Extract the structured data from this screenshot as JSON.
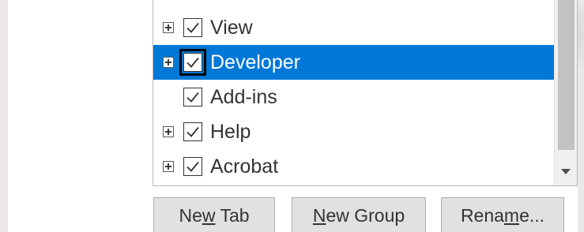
{
  "tree": {
    "rows": [
      {
        "label": "View",
        "expandable": true,
        "checked": true,
        "selected": false
      },
      {
        "label": "Developer",
        "expandable": true,
        "checked": true,
        "selected": true
      },
      {
        "label": "Add-ins",
        "expandable": false,
        "checked": true,
        "selected": false
      },
      {
        "label": "Help",
        "expandable": true,
        "checked": true,
        "selected": false
      },
      {
        "label": "Acrobat",
        "expandable": true,
        "checked": true,
        "selected": false
      }
    ]
  },
  "buttons": {
    "new_tab": {
      "before": "Ne",
      "mnemonic": "w",
      "after": " Tab"
    },
    "new_group": {
      "before": "",
      "mnemonic": "N",
      "after": "ew Group"
    },
    "rename": {
      "before": "Rena",
      "mnemonic": "m",
      "after": "e..."
    }
  },
  "colors": {
    "selection": "#0078d7",
    "button_face": "#e1e1e1",
    "scroll_thumb": "#c2c2c2"
  }
}
